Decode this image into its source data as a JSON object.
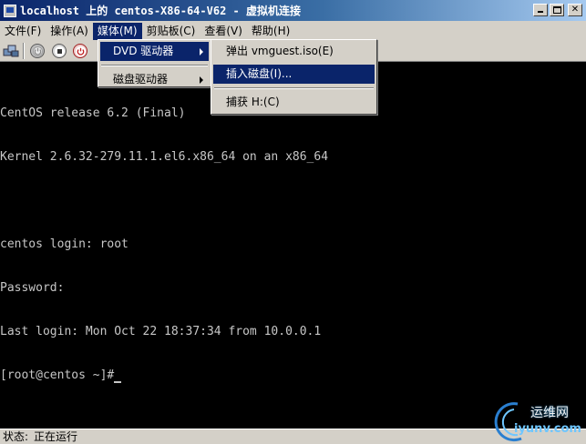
{
  "window": {
    "title": "localhost 上的 centos-X86-64-V62 - 虚拟机连接"
  },
  "menubar": {
    "items": [
      {
        "label": "文件(F)"
      },
      {
        "label": "操作(A)"
      },
      {
        "label": "媒体(M)"
      },
      {
        "label": "剪贴板(C)"
      },
      {
        "label": "查看(V)"
      },
      {
        "label": "帮助(H)"
      }
    ]
  },
  "media_menu": {
    "items": [
      {
        "label": "DVD 驱动器"
      },
      {
        "label": "磁盘驱动器"
      }
    ]
  },
  "dvd_submenu": {
    "items": [
      {
        "label": "弹出 vmguest.iso(E)"
      },
      {
        "label": "插入磁盘(I)..."
      },
      {
        "label": "捕获 H:(C)"
      }
    ]
  },
  "console": {
    "lines": [
      "CentOS release 6.2 (Final)",
      "Kernel 2.6.32-279.11.1.el6.x86_64 on an x86_64",
      "",
      "centos login: root",
      "Password:",
      "Last login: Mon Oct 22 18:37:34 from 10.0.0.1",
      "[root@centos ~]#"
    ]
  },
  "statusbar": {
    "label": "状态:",
    "value": "正在运行"
  },
  "watermark": {
    "cn": "运维网",
    "en": "iyunv.com"
  },
  "colors": {
    "titlebar_start": "#0a246a",
    "menu_highlight": "#0a246a",
    "chrome": "#d4d0c8",
    "console_bg": "#000000",
    "console_fg": "#c7c7c7"
  }
}
